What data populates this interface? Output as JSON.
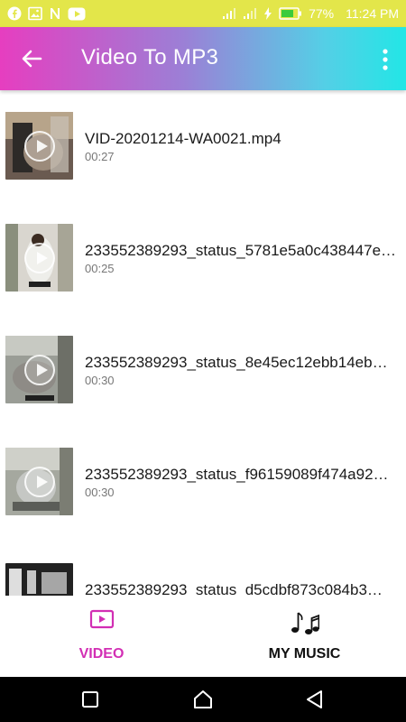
{
  "status_bar": {
    "battery": "77%",
    "time": "11:24 PM",
    "left_icons": [
      "facebook-icon",
      "image-icon",
      "n-app-icon",
      "youtube-icon"
    ],
    "right_icons": [
      "signal-icon",
      "signal-icon",
      "charging-icon",
      "battery-icon"
    ]
  },
  "app_bar": {
    "title": "Video To MP3",
    "back_icon": "arrow-left-icon",
    "menu_icon": "more-vertical-icon",
    "gradient_colors": [
      "#e63ec0",
      "#9c7fd6",
      "#22e6e6"
    ]
  },
  "videos": [
    {
      "name": "VID-20201214-WA0021.mp4",
      "duration": "00:27"
    },
    {
      "name": "233552389293_status_5781e5a0c438447e…",
      "duration": "00:25"
    },
    {
      "name": "233552389293_status_8e45ec12ebb14eb…",
      "duration": "00:30"
    },
    {
      "name": "233552389293_status_f96159089f474a92…",
      "duration": "00:30"
    },
    {
      "name": "233552389293_status_d5cdbf873c084b3…",
      "duration": ""
    }
  ],
  "bottom_nav": {
    "tabs": [
      {
        "label": "VIDEO",
        "icon": "video-play-icon",
        "active": true,
        "color": "#d22fb4"
      },
      {
        "label": "MY MUSIC",
        "icon": "music-notes-icon",
        "active": false,
        "color": "#111111"
      }
    ]
  },
  "system_nav": {
    "icons": [
      "recents-square-icon",
      "home-icon",
      "back-triangle-icon"
    ]
  }
}
